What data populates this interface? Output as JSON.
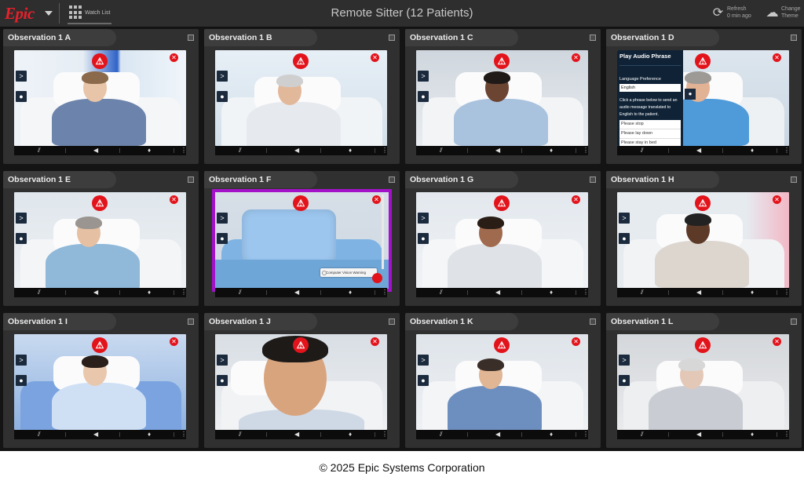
{
  "header": {
    "logo_text": "Epic",
    "watch_list_label": "Watch List",
    "title": "Remote Sitter (12 Patients)",
    "refresh_label": "Refresh",
    "refresh_time": "0 min ago",
    "theme_label_1": "Change",
    "theme_label_2": "Theme",
    "colors": {
      "brand_red": "#e8202b",
      "selected_border": "#a311c8",
      "alert_red": "#e3131b"
    }
  },
  "tiles": [
    {
      "name": "Observation 1 A",
      "selected": false
    },
    {
      "name": "Observation 1 B",
      "selected": false
    },
    {
      "name": "Observation 1 C",
      "selected": false
    },
    {
      "name": "Observation 1 D",
      "selected": false
    },
    {
      "name": "Observation 1 E",
      "selected": false
    },
    {
      "name": "Observation 1 F",
      "selected": true
    },
    {
      "name": "Observation 1 G",
      "selected": false
    },
    {
      "name": "Observation 1 H",
      "selected": false
    },
    {
      "name": "Observation 1 I",
      "selected": false
    },
    {
      "name": "Observation 1 J",
      "selected": false
    },
    {
      "name": "Observation 1 K",
      "selected": false
    },
    {
      "name": "Observation 1 L",
      "selected": false
    }
  ],
  "audio_panel": {
    "title": "Play Audio Phrase",
    "language_label": "Language Preference",
    "language_value": "English",
    "instructions": "Click a phrase below to send an audio message translated to English to the patient.",
    "phrases": [
      "Please stop",
      "Please lay down",
      "Please stay in bed"
    ]
  },
  "computer_vision_label": "Computer Vision Warning",
  "icons": {
    "alert": "warning-triangle-icon",
    "dismiss": "close-circle-icon",
    "expand": "chevron-right-icon",
    "chat": "chat-bubble-icon",
    "patient": "patient-figure-icon",
    "speaker": "speaker-icon",
    "microphone": "microphone-icon",
    "more": "more-vertical-icon"
  },
  "footer": {
    "copyright": "© 2025 Epic Systems Corporation"
  }
}
